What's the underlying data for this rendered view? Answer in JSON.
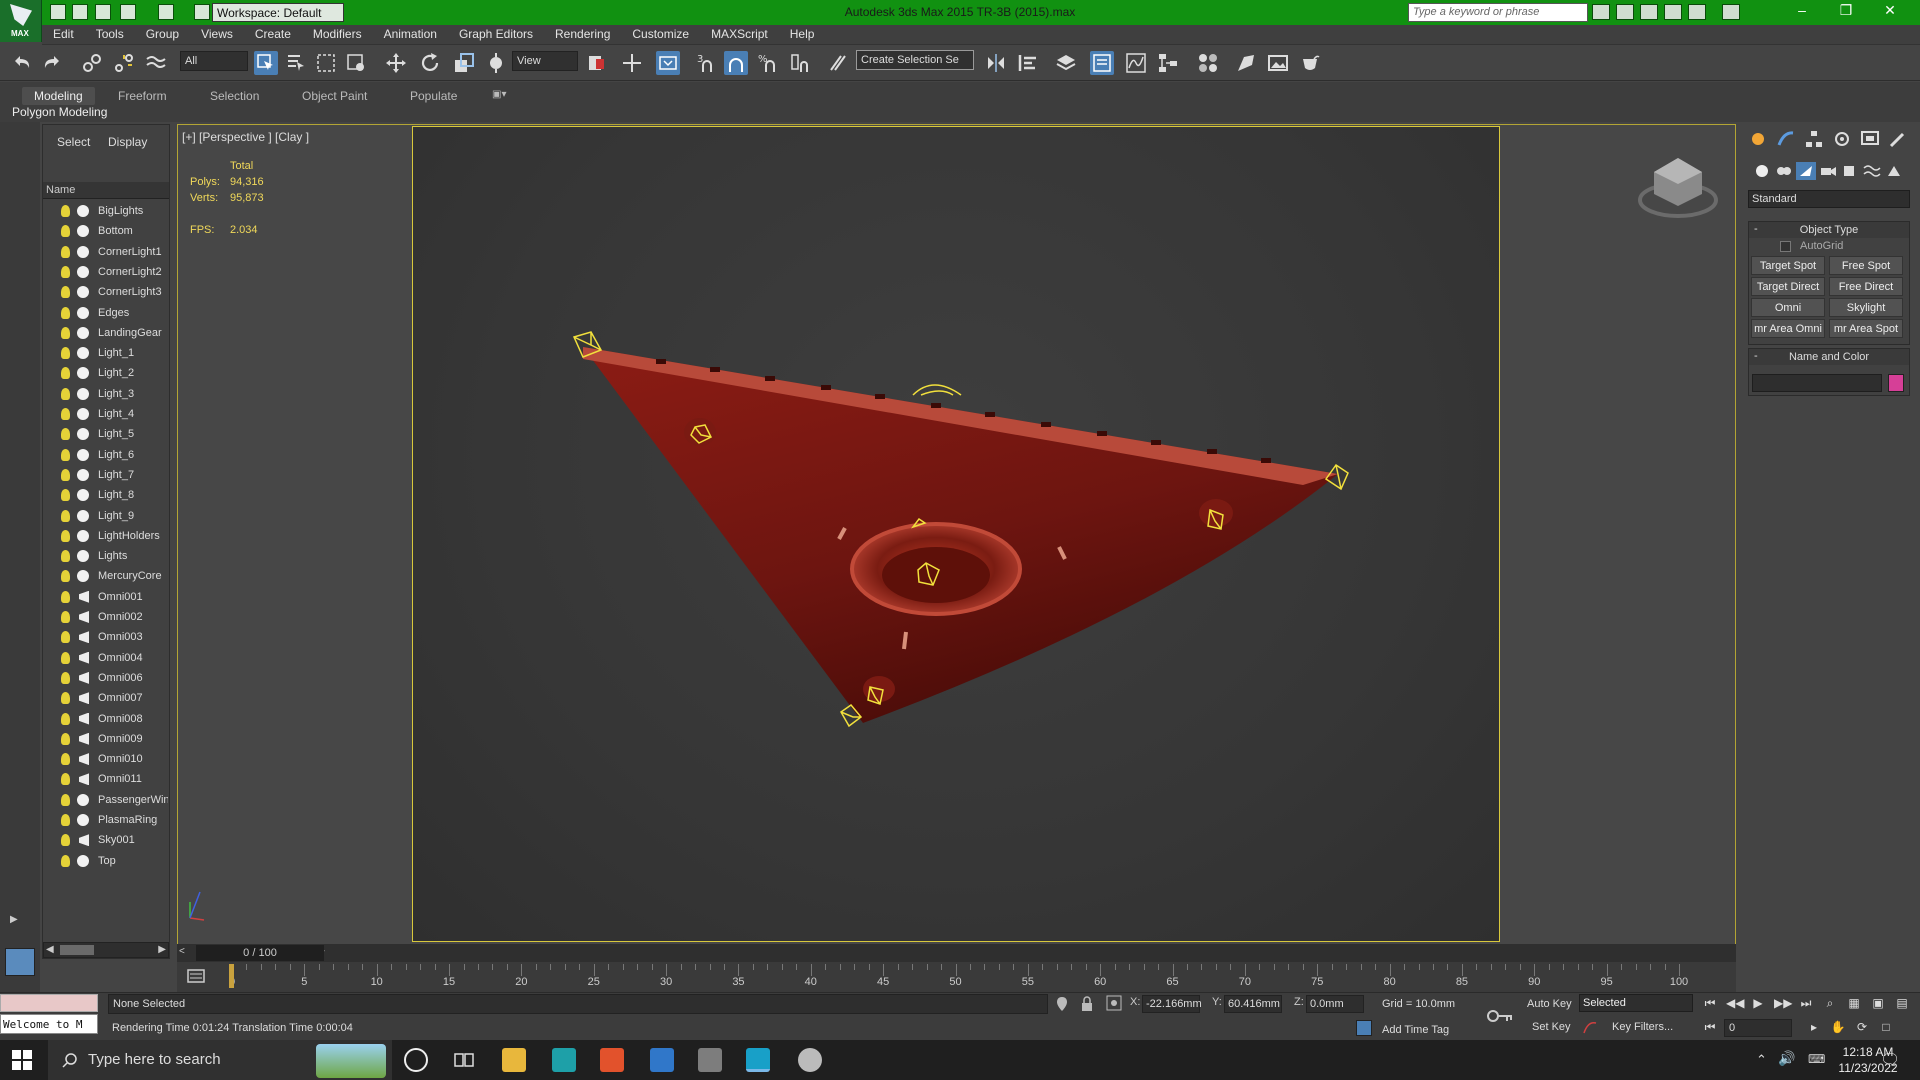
{
  "window": {
    "title": "Autodesk 3ds Max  2015    TR-3B (2015).max",
    "workspace": "Workspace: Default",
    "search_placeholder": "Type a keyword or phrase",
    "logo_text": "MAX"
  },
  "menu": [
    "Edit",
    "Tools",
    "Group",
    "Views",
    "Create",
    "Modifiers",
    "Animation",
    "Graph Editors",
    "Rendering",
    "Customize",
    "MAXScript",
    "Help"
  ],
  "toolbar": {
    "filter": "All",
    "ref_coord": "View",
    "selection_set": "Create Selection Se",
    "snap_label": "3"
  },
  "ribbon": {
    "tabs": [
      "Modeling",
      "Freeform",
      "Selection",
      "Object Paint",
      "Populate"
    ],
    "active_tab": "Modeling",
    "panel_label": "Polygon Modeling"
  },
  "scene_explorer": {
    "tabs": [
      "Select",
      "Display"
    ],
    "column": "Name",
    "items": [
      {
        "name": "BigLights",
        "type": "geo"
      },
      {
        "name": "Bottom",
        "type": "geo"
      },
      {
        "name": "CornerLight1",
        "type": "geo"
      },
      {
        "name": "CornerLight2",
        "type": "geo"
      },
      {
        "name": "CornerLight3",
        "type": "geo"
      },
      {
        "name": "Edges",
        "type": "geo"
      },
      {
        "name": "LandingGear",
        "type": "geo"
      },
      {
        "name": "Light_1",
        "type": "geo"
      },
      {
        "name": "Light_2",
        "type": "geo"
      },
      {
        "name": "Light_3",
        "type": "geo"
      },
      {
        "name": "Light_4",
        "type": "geo"
      },
      {
        "name": "Light_5",
        "type": "geo"
      },
      {
        "name": "Light_6",
        "type": "geo"
      },
      {
        "name": "Light_7",
        "type": "geo"
      },
      {
        "name": "Light_8",
        "type": "geo"
      },
      {
        "name": "Light_9",
        "type": "geo"
      },
      {
        "name": "LightHolders",
        "type": "geo"
      },
      {
        "name": "Lights",
        "type": "geo"
      },
      {
        "name": "MercuryCore",
        "type": "geo"
      },
      {
        "name": "Omni001",
        "type": "omni"
      },
      {
        "name": "Omni002",
        "type": "omni"
      },
      {
        "name": "Omni003",
        "type": "omni"
      },
      {
        "name": "Omni004",
        "type": "omni"
      },
      {
        "name": "Omni006",
        "type": "omni"
      },
      {
        "name": "Omni007",
        "type": "omni"
      },
      {
        "name": "Omni008",
        "type": "omni"
      },
      {
        "name": "Omni009",
        "type": "omni"
      },
      {
        "name": "Omni010",
        "type": "omni"
      },
      {
        "name": "Omni011",
        "type": "omni"
      },
      {
        "name": "PassengerWind",
        "type": "geo"
      },
      {
        "name": "PlasmaRing",
        "type": "geo"
      },
      {
        "name": "Sky001",
        "type": "omni"
      },
      {
        "name": "Top",
        "type": "geo"
      }
    ]
  },
  "viewport": {
    "label": "[+] [Perspective ] [Clay ]",
    "stats": {
      "total_label": "Total",
      "polys_label": "Polys:",
      "polys": "94,316",
      "verts_label": "Verts:",
      "verts": "95,873",
      "fps_label": "FPS:",
      "fps": "2.034"
    },
    "model_color": "#8c1c14",
    "light_gizmo_color": "#f2e03c"
  },
  "command_panel": {
    "category": "Standard",
    "object_type": {
      "title": "Object Type",
      "autogrid": "AutoGrid",
      "buttons": [
        "Target Spot",
        "Free Spot",
        "Target Direct",
        "Free Direct",
        "Omni",
        "Skylight",
        "mr Area Omni",
        "mr Area Spot"
      ]
    },
    "name_color": {
      "title": "Name and Color",
      "color": "#d63f97"
    }
  },
  "timeline": {
    "slider": "0 / 100",
    "ticks": [
      "0",
      "5",
      "10",
      "15",
      "20",
      "25",
      "30",
      "35",
      "40",
      "45",
      "50",
      "55",
      "60",
      "65",
      "70",
      "75",
      "80",
      "85",
      "90",
      "95",
      "100"
    ],
    "current_frame": 0
  },
  "status": {
    "welcome": "Welcome to M",
    "selection": "None Selected",
    "prompt": "Rendering Time  0:01:24    Translation Time  0:00:04",
    "x_label": "X:",
    "x": "-22.166mm",
    "y_label": "Y:",
    "y": "60.416mm",
    "z_label": "Z:",
    "z": "0.0mm",
    "grid": "Grid = 10.0mm",
    "add_time_tag": "Add Time Tag",
    "auto_key": "Auto Key",
    "set_key": "Set Key",
    "key_mode": "Selected",
    "key_filters": "Key Filters...",
    "frame": "0"
  },
  "taskbar": {
    "search_placeholder": "Type here to search",
    "time": "12:18 AM",
    "date": "11/23/2022"
  }
}
